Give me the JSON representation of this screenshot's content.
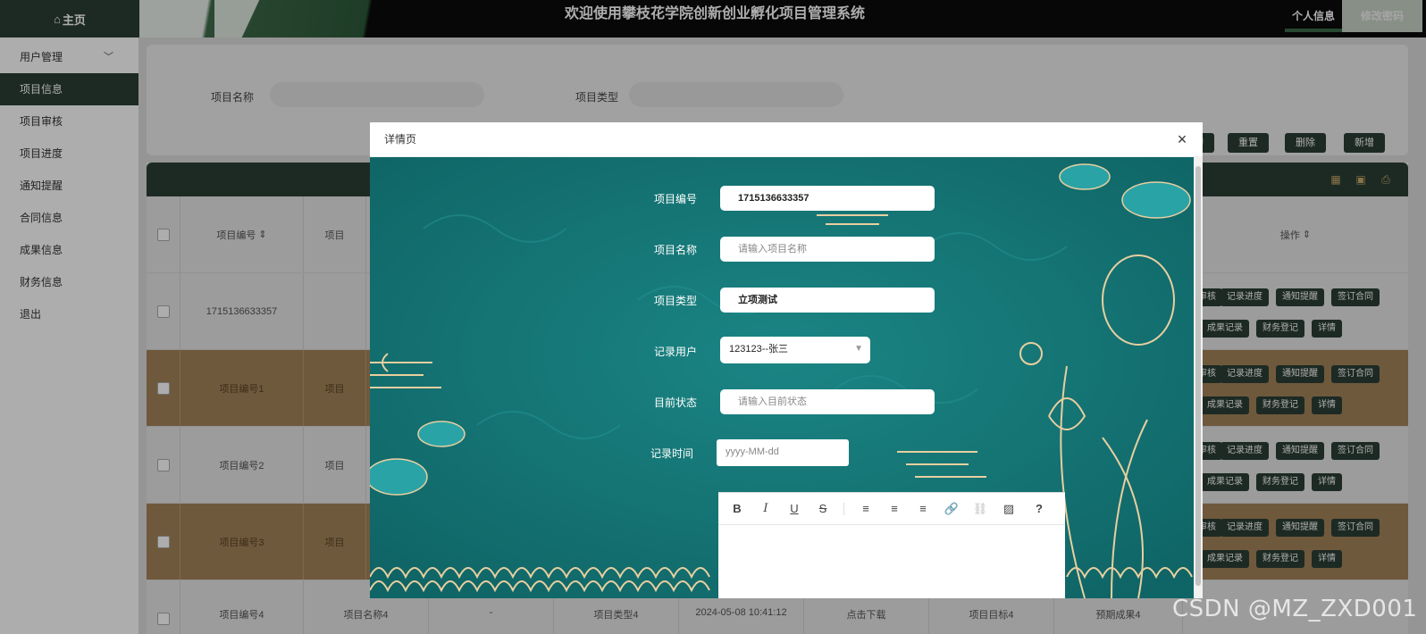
{
  "header": {
    "home_label": "主页",
    "title": "欢迎使用攀枝花学院创新创业孵化项目管理系统",
    "personal_info": "个人信息",
    "change_password": "修改密码"
  },
  "sidebar": {
    "items": [
      {
        "label": "用户管理",
        "expandable": true
      },
      {
        "label": "项目信息",
        "active": true
      },
      {
        "label": "项目审核"
      },
      {
        "label": "项目进度"
      },
      {
        "label": "通知提醒"
      },
      {
        "label": "合同信息"
      },
      {
        "label": "成果信息"
      },
      {
        "label": "财务信息"
      },
      {
        "label": "退出"
      }
    ]
  },
  "search": {
    "name_label": "项目名称",
    "type_label": "项目类型",
    "query_button": "询",
    "reset_button": "重置",
    "delete_button": "删除",
    "add_button": "新增"
  },
  "table": {
    "columns": [
      "项目编号",
      "项目",
      "操作"
    ],
    "rows": [
      {
        "id": "1715136633357",
        "name": ""
      },
      {
        "id": "项目编号1",
        "name": "项目"
      },
      {
        "id": "项目编号2",
        "name": "项目"
      },
      {
        "id": "项目编号3",
        "name": "项目"
      },
      {
        "id": "项目编号4",
        "name": "项目名称4",
        "dash": "-",
        "type": "项目类型4",
        "time": "2024-05-08 10:41:12",
        "download": "点击下载",
        "target": "项目目标4",
        "result": "预期成果4"
      }
    ],
    "ops_row1": [
      "交审核",
      "记录进度",
      "通知提醒",
      "签订合同"
    ],
    "ops_row2": [
      "成果记录",
      "财务登记",
      "详情"
    ]
  },
  "modal": {
    "title": "详情页",
    "close": "×",
    "fields": {
      "code_label": "项目编号",
      "code_value": "1715136633357",
      "name_label": "项目名称",
      "name_placeholder": "请输入项目名称",
      "type_label": "项目类型",
      "type_value": "立项测试",
      "user_label": "记录用户",
      "user_value": "123123--张三",
      "status_label": "目前状态",
      "status_placeholder": "请输入目前状态",
      "time_label": "记录时间",
      "time_placeholder": "yyyy-MM-dd"
    },
    "editor_tools": [
      "B",
      "I",
      "U",
      "S",
      "align-left",
      "align-center",
      "align-right",
      "link",
      "unlink",
      "image",
      "?"
    ]
  },
  "watermark": "CSDN @MZ_ZXD001"
}
